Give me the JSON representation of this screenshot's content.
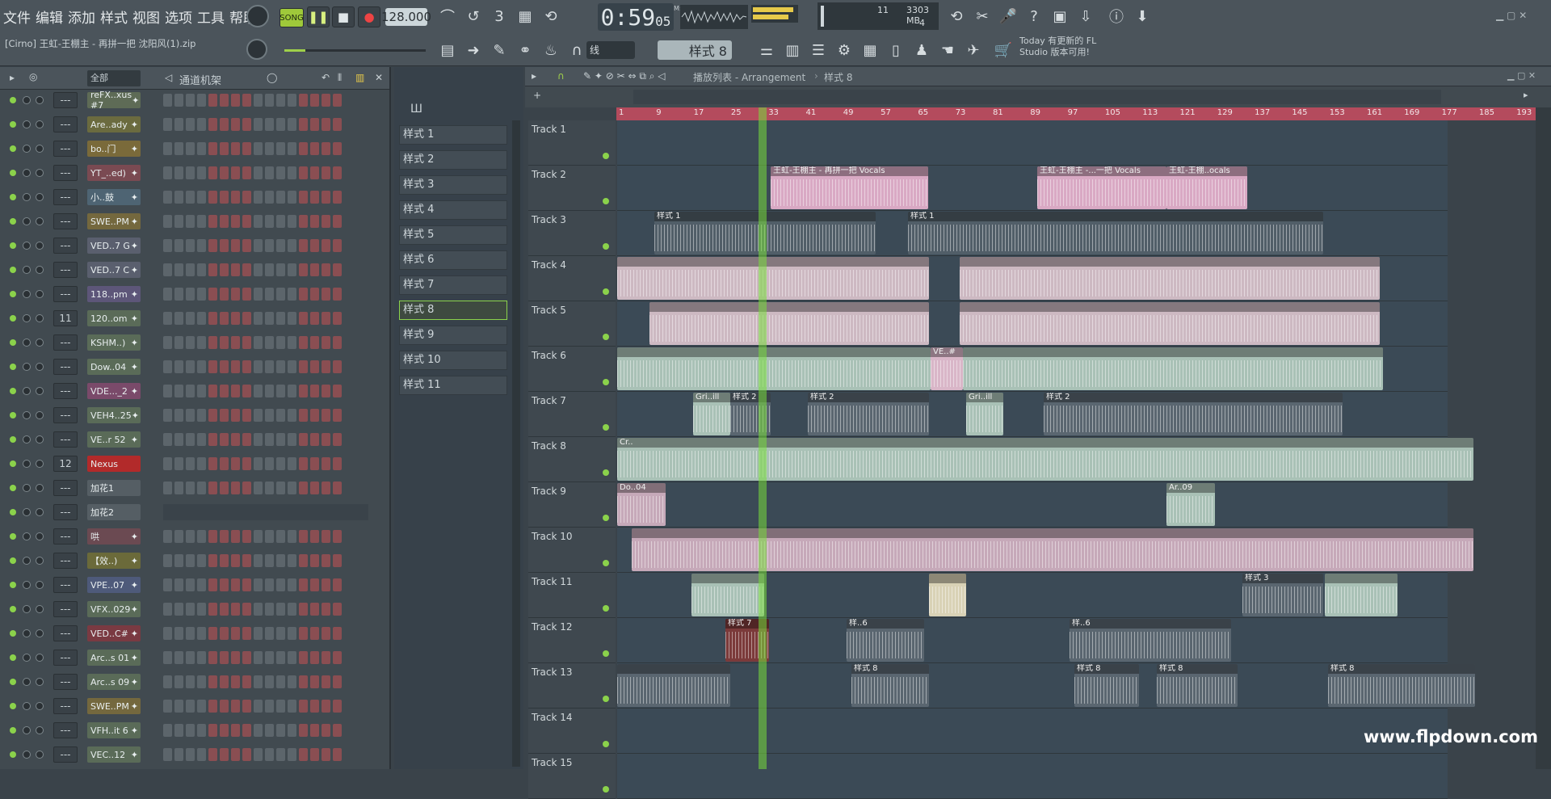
{
  "menu": [
    "文件",
    "编辑",
    "添加",
    "样式",
    "视图",
    "选项",
    "工具",
    "帮助"
  ],
  "transport": {
    "mode": "SONG",
    "tempo": "128.000",
    "time": "0:59",
    "time_sub": "05",
    "time_unit": "M:S:CS"
  },
  "memory": {
    "value": "11",
    "mb": "3303 MB",
    "voices": "4"
  },
  "song_file": "[Cirno] 王虹-王棚主 - 再拼一把 沈阳风(1).zip",
  "snap": "线",
  "pattern_selected": "样式 8",
  "notice": {
    "line1": "Today  有更新的 FL",
    "line2": "Studio 版本可用!"
  },
  "rack": {
    "filter": "全部",
    "title": "通道机架",
    "channels": [
      {
        "name": "reFX..xus #7",
        "num": "---",
        "color": "#5e6b56"
      },
      {
        "name": "Are..ady",
        "num": "---",
        "color": "#6b6b3f"
      },
      {
        "name": "bo..门",
        "num": "---",
        "color": "#7a6a3a"
      },
      {
        "name": "YT_..ed)",
        "num": "---",
        "color": "#7a4a52"
      },
      {
        "name": "小..鼓",
        "num": "---",
        "color": "#4e6473"
      },
      {
        "name": "SWE..PM",
        "num": "---",
        "color": "#74683e"
      },
      {
        "name": "VED..7 G",
        "num": "---",
        "color": "#5a5f6e"
      },
      {
        "name": "VED..7 C",
        "num": "---",
        "color": "#5a5f6e"
      },
      {
        "name": "118..pm",
        "num": "---",
        "color": "#5d5679"
      },
      {
        "name": "120..om",
        "num": "11",
        "color": "#5a6b58"
      },
      {
        "name": "KSHM..)",
        "num": "---",
        "color": "#5a6b58"
      },
      {
        "name": "Dow..04",
        "num": "---",
        "color": "#5a6b58"
      },
      {
        "name": "VDE..._2",
        "num": "---",
        "color": "#7a4a6a"
      },
      {
        "name": "VEH4..25",
        "num": "---",
        "color": "#5a6b58"
      },
      {
        "name": "VE..r 52",
        "num": "---",
        "color": "#5a6b58"
      },
      {
        "name": "Nexus",
        "num": "12",
        "color": "#b22a2a"
      },
      {
        "name": "加花1",
        "num": "---",
        "color": "#555e64"
      },
      {
        "name": "加花2",
        "num": "---",
        "color": "#555e64"
      },
      {
        "name": "哄",
        "num": "---",
        "color": "#6b4a52"
      },
      {
        "name": "【效..)",
        "num": "---",
        "color": "#6b6a3a"
      },
      {
        "name": "VPE..07",
        "num": "---",
        "color": "#4e5a7a"
      },
      {
        "name": "VFX..029",
        "num": "---",
        "color": "#5a6b58"
      },
      {
        "name": "VED..C#",
        "num": "---",
        "color": "#7a3a42"
      },
      {
        "name": "Arc..s 01",
        "num": "---",
        "color": "#5a6b58"
      },
      {
        "name": "Arc..s 09",
        "num": "---",
        "color": "#5a6b58"
      },
      {
        "name": "SWE..PM",
        "num": "---",
        "color": "#74683e"
      },
      {
        "name": "VFH..it 6",
        "num": "---",
        "color": "#5a6b58"
      },
      {
        "name": "VEC..12",
        "num": "---",
        "color": "#5a6b58"
      }
    ]
  },
  "patterns": [
    "样式 1",
    "样式 2",
    "样式 3",
    "样式 4",
    "样式 5",
    "样式 6",
    "样式 7",
    "样式 8",
    "样式 9",
    "样式 10",
    "样式 11"
  ],
  "playlist": {
    "title": "播放列表 - Arrangement",
    "crumb": "样式 8",
    "ruler": [
      "1",
      "9",
      "17",
      "25",
      "33",
      "41",
      "49",
      "57",
      "65",
      "73",
      "81",
      "89",
      "97",
      "105",
      "113",
      "121",
      "129",
      "137",
      "145",
      "153",
      "161",
      "169",
      "177",
      "185",
      "193"
    ],
    "tracks": [
      "Track 1",
      "Track 2",
      "Track 3",
      "Track 4",
      "Track 5",
      "Track 6",
      "Track 7",
      "Track 8",
      "Track 9",
      "Track 10",
      "Track 11",
      "Track 12",
      "Track 13",
      "Track 14",
      "Track 15"
    ],
    "clip_labels": {
      "vocal_a": "王虹-王棚主 - 再拼一把 Vocals",
      "vocal_b": "王虹-王棚主 -...一把 Vocals",
      "vocal_c": "王虹-王棚..ocals",
      "pat1": "样式 1",
      "pat2": "样式 2",
      "pat3": "样式 3",
      "pat6": "样..6",
      "pat7": "样式 7",
      "pat8": "样式 8",
      "ve": "VE..#",
      "gri": "Gri..ill",
      "cr": "Cr..",
      "do": "Do..04",
      "ar": "Ar..09"
    }
  },
  "watermark": "www.flpdown.com"
}
